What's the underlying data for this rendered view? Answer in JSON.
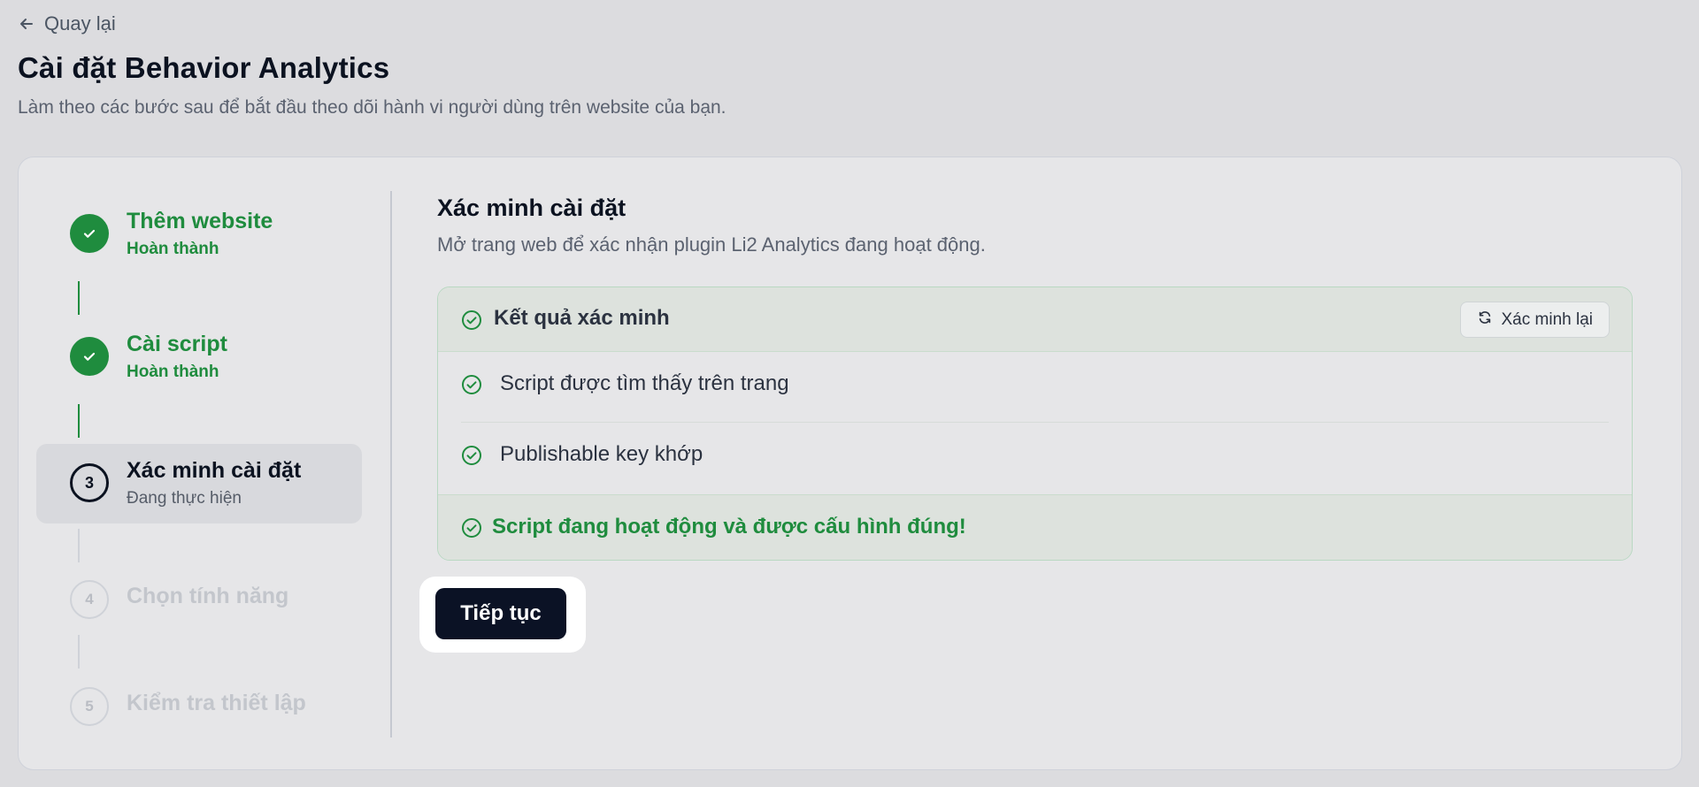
{
  "nav": {
    "back_label": "Quay lại"
  },
  "header": {
    "title": "Cài đặt Behavior Analytics",
    "subtitle": "Làm theo các bước sau để bắt đầu theo dõi hành vi người dùng trên website của bạn."
  },
  "stepper": {
    "steps": [
      {
        "number": "1",
        "label": "Thêm website",
        "status": "Hoàn thành",
        "state": "done"
      },
      {
        "number": "2",
        "label": "Cài script",
        "status": "Hoàn thành",
        "state": "done"
      },
      {
        "number": "3",
        "label": "Xác minh cài đặt",
        "status": "Đang thực hiện",
        "state": "current"
      },
      {
        "number": "4",
        "label": "Chọn tính năng",
        "status": "",
        "state": "pending"
      },
      {
        "number": "5",
        "label": "Kiểm tra thiết lập",
        "status": "",
        "state": "pending"
      }
    ]
  },
  "main": {
    "title": "Xác minh cài đặt",
    "description": "Mở trang web để xác nhận plugin Li2 Analytics đang hoạt động.",
    "result": {
      "title": "Kết quả xác minh",
      "reverify_label": "Xác minh lại",
      "checks": [
        {
          "label": "Script được tìm thấy trên trang"
        },
        {
          "label": "Publishable key khớp"
        }
      ],
      "summary": "Script đang hoạt động và được cấu hình đúng!"
    },
    "continue_label": "Tiếp tục"
  },
  "colors": {
    "success": "#1f8c3e",
    "primary_button": "#0b1225",
    "background": "#dcdcdf"
  }
}
